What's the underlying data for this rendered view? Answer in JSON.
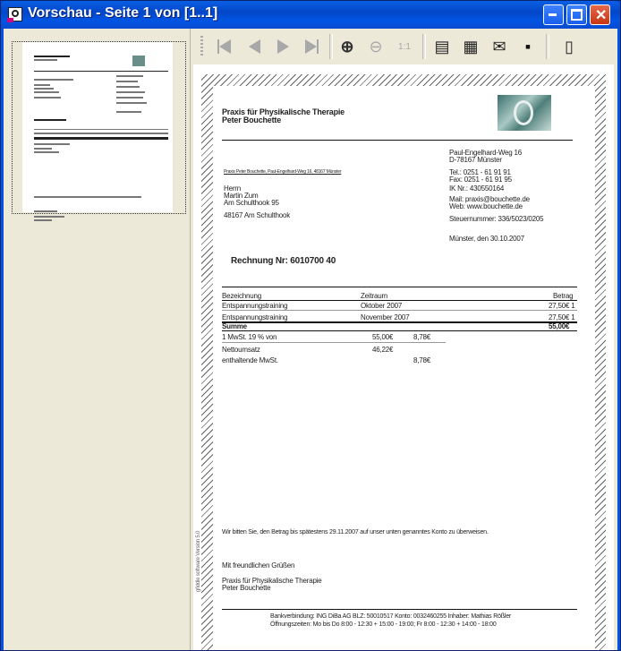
{
  "window": {
    "title": "Vorschau - Seite 1 von [1..1]"
  },
  "titlebar_buttons": {
    "minimize": "_",
    "maximize": "□",
    "close": "✕"
  },
  "toolbar": {
    "first_icon": "first-page-icon",
    "prev_icon": "previous-page-icon",
    "next_icon": "next-page-icon",
    "last_icon": "last-page-icon",
    "zoom_in_icon": "zoom-in-icon",
    "zoom_out_icon": "zoom-out-icon",
    "zoom_reset_label": "1:1",
    "print_icon": "print-icon",
    "print_setup_icon": "printer-setup-icon",
    "email_icon": "email-icon",
    "save_icon": "save-icon",
    "exit_icon": "exit-door-icon"
  },
  "document": {
    "header_line1": "Praxis für Physikalische Therapie",
    "header_line2": "Peter Bouchette",
    "sender_line": "Praxis Peter Bouchette, Paul-Engelhard-Weg 16, 48167 Münster",
    "address": [
      "Herrn",
      "Martin Zum",
      "Am Schulthook 95",
      "",
      "48167 Am Schulthook"
    ],
    "contact_addr": [
      "Paul-Engelhard-Weg 16",
      "D-78167 Münster"
    ],
    "contact_tel": [
      "Tel.: 0251 - 61 91 91",
      "Fax: 0251 - 61 91 95"
    ],
    "contact_ik": "IK Nr.: 430550164",
    "contact_web": [
      "Mail: praxis@bouchette.de",
      "Web: www.bouchette.de"
    ],
    "contact_tax": "Steuernummer: 336/5023/0205",
    "date_line": "Münster, den 30.10.2007",
    "invoice_title": "Rechnung Nr: 6010700 40",
    "table": {
      "headers": [
        "Bezeichnung",
        "Zeitraum",
        "Betrag"
      ],
      "rows": [
        [
          "Entspannungstraining",
          "Oktober 2007",
          "27,50€  1"
        ],
        [
          "Entspannungstraining",
          "November 2007",
          "27,50€  1"
        ]
      ],
      "sum_label": "Summe",
      "sum_value": "55,00€"
    },
    "tax": [
      [
        "1 MwSt. 19 % von",
        "55,00€",
        "8,78€"
      ],
      [
        "Nettoumsatz",
        "46,22€",
        ""
      ],
      [
        "enthaltende MwSt.",
        "",
        "8,78€"
      ]
    ],
    "payment_note": "Wir bitten Sie, den Betrag bis spätestens 29.11.2007 auf unser unten genanntes Konto zu überweisen.",
    "greeting": "Mit freundlichen Grüßen",
    "signature": [
      "Praxis für Physikalische Therapie",
      "Peter Bouchette"
    ],
    "footer1": "Bankverbindung: ING DiBa AG BLZ: 50010517 Konto: 0032460255 Inhaber: Mathias Rößler",
    "footer2": "Öffnungszeiten: Mo bis Do 8:00 - 12:30 + 15:00 - 19:00; Fr 8:00 - 12:30 + 14:00 - 18:00",
    "side_note": "gfiddle software Version 5.0"
  }
}
